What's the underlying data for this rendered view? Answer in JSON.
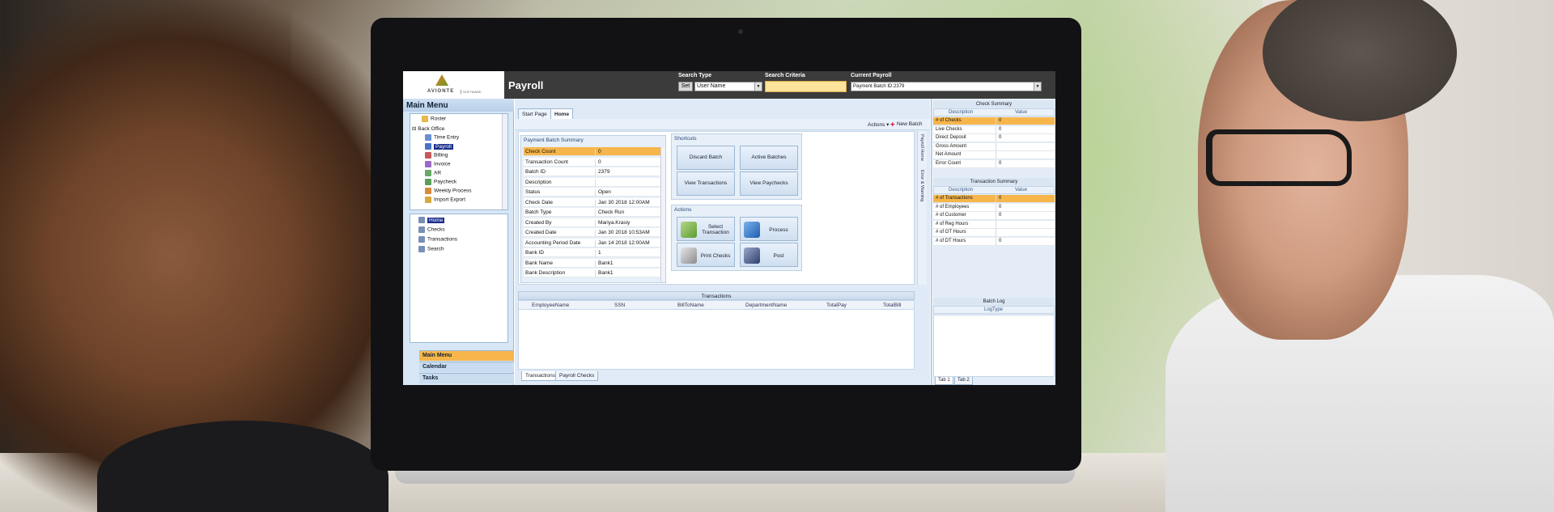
{
  "header": {
    "logo_text": "AVIONTE",
    "logo_sub": "SOFTWARE",
    "title": "Payroll",
    "search_type_label": "Search Type",
    "set_label": "Set",
    "search_type_value": "User Name",
    "search_criteria_label": "Search Criteria",
    "search_criteria_value": "",
    "current_payroll_label": "Current Payroll",
    "current_payroll_value": "Payment Batch ID:2379"
  },
  "nav": {
    "title": "Main Menu",
    "tree": [
      {
        "label": "Roster",
        "icon": "folder-icon"
      },
      {
        "label": "Back Office",
        "icon": "expander-icon"
      },
      {
        "label": "Time Entry",
        "icon": "clock-icon"
      },
      {
        "label": "Payroll",
        "icon": "payroll-icon",
        "selected": true
      },
      {
        "label": "Billing",
        "icon": "billing-icon"
      },
      {
        "label": "Invoice",
        "icon": "invoice-icon"
      },
      {
        "label": "AR",
        "icon": "ar-icon"
      },
      {
        "label": "Paycheck",
        "icon": "paycheck-icon"
      },
      {
        "label": "Weekly Process",
        "icon": "process-icon"
      },
      {
        "label": "Import Export",
        "icon": "import-icon"
      }
    ],
    "sub_items": [
      {
        "label": "Home",
        "selected": true
      },
      {
        "label": "Checks"
      },
      {
        "label": "Transactions"
      },
      {
        "label": "Search"
      }
    ],
    "bottom_tabs": [
      "Main Menu",
      "Calendar",
      "Tasks"
    ]
  },
  "center": {
    "tabs": [
      "Start Page",
      "Home"
    ],
    "toolbar": {
      "actions": "Actions ▾",
      "new_batch": "New Batch"
    },
    "summary": {
      "title": "Payment Batch Summary",
      "rows": [
        {
          "k": "Check Count",
          "v": "0"
        },
        {
          "k": "Transaction Count",
          "v": "0"
        },
        {
          "k": "Batch ID",
          "v": "2379"
        },
        {
          "k": "Description",
          "v": ""
        },
        {
          "k": "Status",
          "v": "Open"
        },
        {
          "k": "Check Date",
          "v": "Jan 30 2018 12:00AM"
        },
        {
          "k": "Batch Type",
          "v": "Check Run"
        },
        {
          "k": "Created By",
          "v": "Mariya.Krasiy"
        },
        {
          "k": "Created Date",
          "v": "Jan 30 2018 10:53AM"
        },
        {
          "k": "Accounting Period Date",
          "v": "Jan 14 2018 12:00AM"
        },
        {
          "k": "Bank ID",
          "v": "1"
        },
        {
          "k": "Bank Name",
          "v": "Bank1"
        },
        {
          "k": "Bank Description",
          "v": "Bank1"
        }
      ]
    },
    "shortcuts": {
      "title": "Shortcuts",
      "buttons": [
        "Discard Batch",
        "Active Batches",
        "View Transactions",
        "View Paychecks"
      ]
    },
    "actions": {
      "title": "Actions",
      "buttons": [
        "Select Transaction",
        "Process",
        "Print Checks",
        "Post"
      ]
    },
    "vtabs": [
      "Payroll Home",
      "Error & Warning"
    ],
    "grid": {
      "title": "Transactions",
      "columns": [
        "EmployeeName",
        "SSN",
        "BillToName",
        "DepartmentName",
        "TotalPay",
        "TotalBill"
      ]
    },
    "bottom_tabs": [
      "Transactions",
      "Payroll Checks"
    ]
  },
  "right": {
    "check_summary": {
      "title": "Check Summary",
      "cols": [
        "Description",
        "Value"
      ],
      "rows": [
        {
          "k": "# of Checks",
          "v": "0",
          "hl": true
        },
        {
          "k": "Live Checks",
          "v": "0"
        },
        {
          "k": "Direct Deposit",
          "v": "0"
        },
        {
          "k": "Gross Amount",
          "v": ""
        },
        {
          "k": "Net Amount",
          "v": ""
        },
        {
          "k": "Error Count",
          "v": "0"
        }
      ]
    },
    "transaction_summary": {
      "title": "Transaction Summary",
      "cols": [
        "Description",
        "Value"
      ],
      "rows": [
        {
          "k": "# of Transactions",
          "v": "0",
          "hl": true
        },
        {
          "k": "# of Employees",
          "v": "0"
        },
        {
          "k": "# of Customer",
          "v": "0"
        },
        {
          "k": "# of Reg Hours",
          "v": ""
        },
        {
          "k": "# of OT Hours",
          "v": ""
        },
        {
          "k": "# of DT Hours",
          "v": "0"
        }
      ]
    },
    "batch_log": {
      "title": "Batch Log",
      "col": "LogType"
    },
    "tabs": [
      "Tab 1",
      "Tab 2"
    ]
  },
  "colors": {
    "accent": "#f6b64c",
    "header": "#3b3b3b",
    "panel": "#dfeaf6",
    "selection": "#1a2e8c"
  }
}
